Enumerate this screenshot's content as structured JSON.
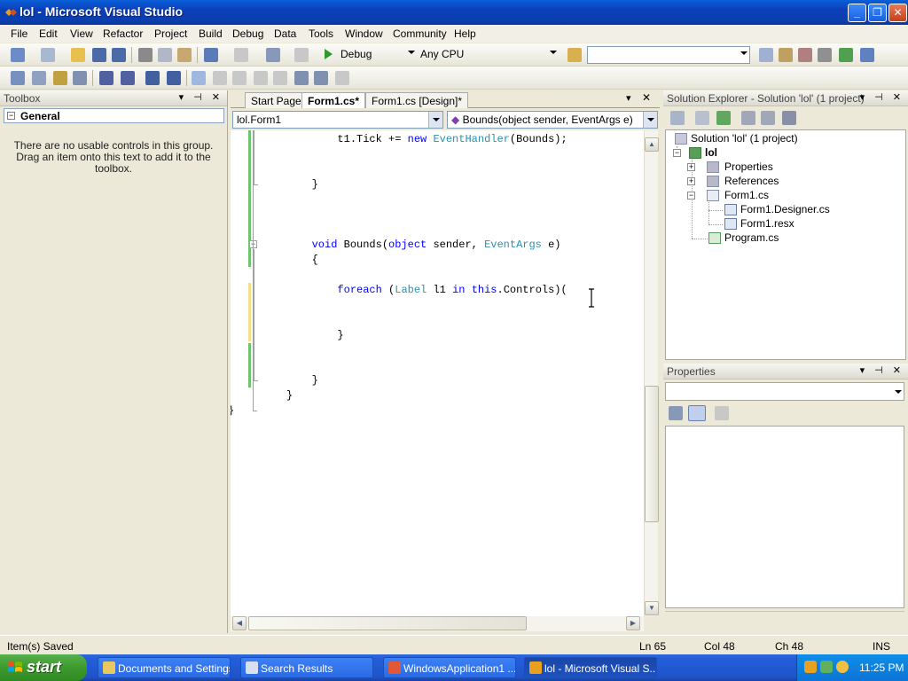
{
  "window": {
    "title": "lol - Microsoft Visual Studio"
  },
  "menu": [
    "File",
    "Edit",
    "View",
    "Refactor",
    "Project",
    "Build",
    "Debug",
    "Data",
    "Tools",
    "Window",
    "Community",
    "Help"
  ],
  "toolbar": {
    "config": "Debug",
    "platform": "Any CPU",
    "find": ""
  },
  "toolbox": {
    "title": "Toolbox",
    "group": "General",
    "empty_message": "There are no usable controls in this group. Drag an item onto this text to add it to the toolbox."
  },
  "editor": {
    "tabs": [
      "Start Page",
      "Form1.cs*",
      "Form1.cs [Design]*"
    ],
    "active_tab": 1,
    "class_dropdown": "lol.Form1",
    "member_dropdown": "Bounds(object sender, EventArgs e)",
    "code": [
      {
        "indent": "            ",
        "parts": [
          [
            "",
            "t1.Tick += "
          ],
          [
            "kw",
            "new"
          ],
          [
            "",
            " "
          ],
          [
            "ty",
            "EventHandler"
          ],
          [
            "",
            "(Bounds);"
          ]
        ]
      },
      {
        "indent": "        ",
        "parts": [
          [
            "",
            "}"
          ]
        ]
      },
      {
        "indent": "        ",
        "parts": [
          [
            "kw",
            "void"
          ],
          [
            "",
            " Bounds("
          ],
          [
            "kw",
            "object"
          ],
          [
            "",
            " sender, "
          ],
          [
            "ty",
            "EventArgs"
          ],
          [
            "",
            " e)"
          ]
        ]
      },
      {
        "indent": "        ",
        "parts": [
          [
            "",
            "{"
          ]
        ]
      },
      {
        "indent": "            ",
        "parts": [
          [
            "kw",
            "foreach"
          ],
          [
            "",
            " ("
          ],
          [
            "ty",
            "Label"
          ],
          [
            "",
            " l1 "
          ],
          [
            "kw",
            "in"
          ],
          [
            "",
            " "
          ],
          [
            "kw",
            "this"
          ],
          [
            "",
            ".Controls)("
          ]
        ]
      },
      {
        "indent": "            ",
        "parts": [
          [
            "",
            "}"
          ]
        ]
      },
      {
        "indent": "        ",
        "parts": [
          [
            "",
            "}"
          ]
        ]
      },
      {
        "indent": "    ",
        "parts": [
          [
            "",
            "}"
          ]
        ]
      },
      {
        "indent": "",
        "parts": [
          [
            "",
            "}"
          ]
        ]
      }
    ]
  },
  "solution_explorer": {
    "title": "Solution Explorer - Solution 'lol' (1 project)",
    "items": [
      {
        "label": "Solution 'lol' (1 project)",
        "icon": "solution-icon"
      },
      {
        "label": "lol",
        "icon": "csharp-project-icon"
      },
      {
        "label": "Properties",
        "icon": "properties-folder-icon"
      },
      {
        "label": "References",
        "icon": "references-folder-icon"
      },
      {
        "label": "Form1.cs",
        "icon": "form-file-icon"
      },
      {
        "label": "Form1.Designer.cs",
        "icon": "cs-file-icon"
      },
      {
        "label": "Form1.resx",
        "icon": "resx-file-icon"
      },
      {
        "label": "Program.cs",
        "icon": "cs-file-icon"
      }
    ]
  },
  "properties": {
    "title": "Properties"
  },
  "status": {
    "message": "Item(s) Saved",
    "line": "Ln 65",
    "col": "Col 48",
    "ch": "Ch 48",
    "mode": "INS"
  },
  "taskbar": {
    "start": "start",
    "buttons": [
      "Documents and Settings",
      "Search Results",
      "WindowsApplication1 ...",
      "lol - Microsoft Visual S..."
    ],
    "clock": "11:25 PM"
  },
  "colors": {
    "keyword": "#0000ff",
    "type": "#2b91af",
    "titlebar": "#0a4fc8"
  }
}
